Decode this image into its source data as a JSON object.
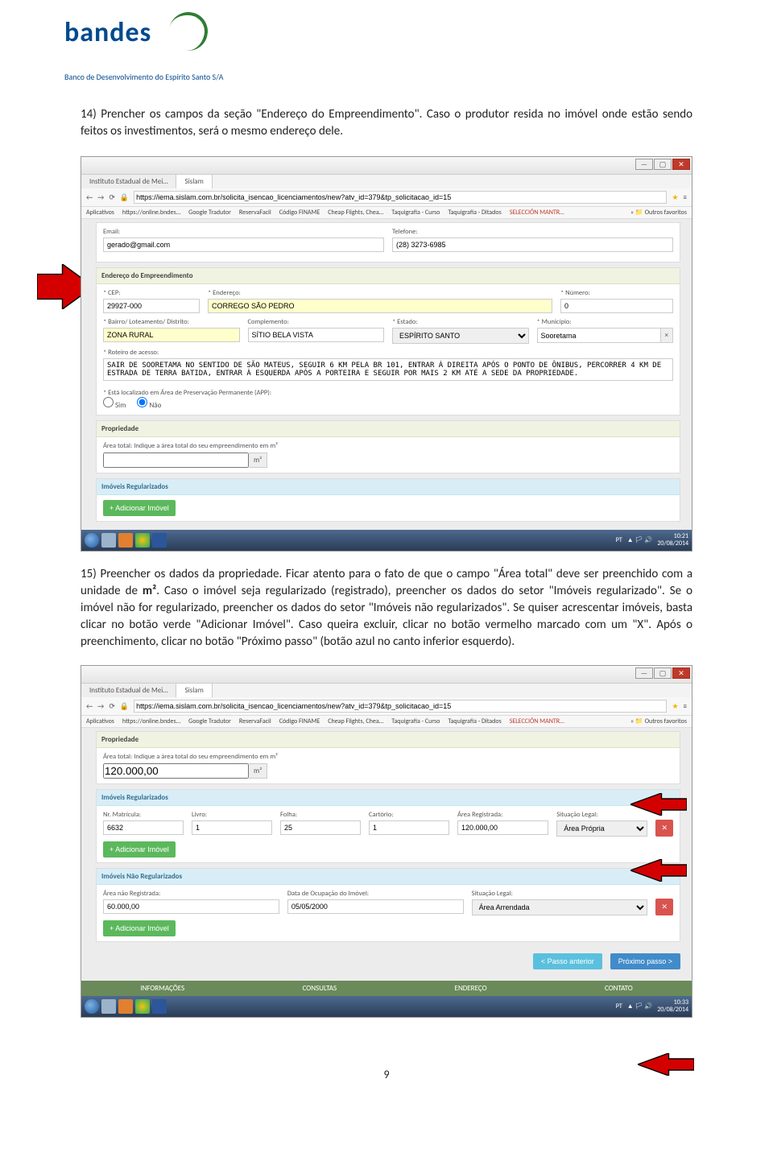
{
  "logo": {
    "brand": "bandes",
    "tagline": "Banco de Desenvolvimento do Espírito Santo S/A"
  },
  "para1": "14) Prencher os campos da seção \"Endereço do Empreendimento\". Caso o produtor resida no imóvel onde estão sendo feitos os investimentos, será o mesmo endereço dele.",
  "para2_a": "15) Preencher os dados da propriedade. Ficar atento para o fato de que o campo \"Área total\" deve ser preenchido com a unidade de ",
  "para2_bold": "m²",
  "para2_b": ". Caso o imóvel seja regularizado (registrado), preencher os dados do setor \"Imóveis regularizado\". Se o imóvel não for regularizado, preencher os dados do setor \"Imóveis não regularizados\". Se quiser acrescentar imóveis, basta clicar no botão verde \"Adicionar Imóvel\". Caso queira excluir, clicar no botão vermelho marcado com um \"X\". Após o preenchimento, clicar no botão \"Próximo passo\" (botão azul no canto inferior esquerdo).",
  "ss1": {
    "tab1": "Instituto Estadual de Mei…",
    "tab2": "Sislam",
    "url": "https://iema.sislam.com.br/solicita_isencao_licenciamentos/new?atv_id=379&tp_solicitacao_id=15",
    "bookmarks": [
      "Aplicativos",
      "https://online.bndes…",
      "Google Tradutor",
      "ReservaFacil",
      "Código FINAME",
      "Cheap Flights, Chea…",
      "Taquigrafia - Curso",
      "Taquigrafia - Ditados",
      "SELECCIÓN MANTR…"
    ],
    "other_fav": "Outros favoritos",
    "email_lbl": "Email:",
    "email_val": "gerado@gmail.com",
    "tel_lbl": "Telefone:",
    "tel_val": "(28) 3273-6985",
    "panel_endereco": "Endereço do Empreendimento",
    "cep_lbl": "* CEP:",
    "cep_val": "29927-000",
    "end_lbl": "* Endereço:",
    "end_val": "CORREGO SÃO PEDRO",
    "num_lbl": "* Número:",
    "num_val": "0",
    "bairro_lbl": "* Bairro/ Loteamento/ Distrito:",
    "bairro_val": "ZONA RURAL",
    "compl_lbl": "Complemento:",
    "compl_val": "SÍTIO BELA VISTA",
    "estado_lbl": "* Estado:",
    "estado_val": "ESPÍRITO SANTO",
    "mun_lbl": "* Município:",
    "mun_val": "Sooretama",
    "rot_lbl": "* Roteiro de acesso:",
    "rot_val": "SAIR DE SOORETAMA NO SENTIDO DE SÃO MATEUS, SEGUIR 6 KM PELA BR 101, ENTRAR À DIREITA APÓS O PONTO DE ÔNIBUS, PERCORRER 4 KM DE ESTRADA DE TERRA BATIDA, ENTRAR À ESQUERDA APÓS A PORTEIRA E SEGUIR POR MAIS 2 KM ATÉ A SEDE DA PROPRIEDADE.",
    "app_lbl": "* Está localizado em Área de Preservação Permanente (APP):",
    "sim": "Sim",
    "nao": "Não",
    "panel_prop": "Propriedade",
    "area_lbl": "Área total: Indique a área total do seu empreendimento em m²",
    "unit": "m²",
    "panel_imoveis": "Imóveis Regularizados",
    "add_btn": "Adicionar Imóvel",
    "clock": "10:21",
    "date": "20/08/2014",
    "lang": "PT"
  },
  "ss2": {
    "tab1": "Instituto Estadual de Mei…",
    "tab2": "Sislam",
    "url": "https://iema.sislam.com.br/solicita_isencao_licenciamentos/new?atv_id=379&tp_solicitacao_id=15",
    "bookmarks": [
      "Aplicativos",
      "https://online.bndes…",
      "Google Tradutor",
      "ReservaFacil",
      "Código FINAME",
      "Cheap Flights, Chea…",
      "Taquigrafia - Curso",
      "Taquigrafia - Ditados",
      "SELECCIÓN MANTR…"
    ],
    "other_fav": "Outros favoritos",
    "panel_prop": "Propriedade",
    "area_lbl": "Área total: Indique a área total do seu empreendimento em m²",
    "area_val": "120.000,00",
    "unit": "m²",
    "panel_reg": "Imóveis Regularizados",
    "nr_mat_lbl": "Nr. Matrícula:",
    "nr_mat_val": "6632",
    "livro_lbl": "Livro:",
    "livro_val": "1",
    "folha_lbl": "Folha:",
    "folha_val": "25",
    "cart_lbl": "Cartório:",
    "cart_val": "1",
    "areareg_lbl": "Área Registrada:",
    "areareg_val": "120.000,00",
    "sit_lbl": "Situação Legal:",
    "sit_val": "Área Própria",
    "add_btn": "Adicionar Imóvel",
    "panel_nreg": "Imóveis Não Regularizados",
    "areanr_lbl": "Área não Registrada:",
    "areanr_val": "60.000,00",
    "dataocp_lbl": "Data de Ocupação do Imóvel:",
    "dataocp_val": "05/05/2000",
    "sit2_lbl": "Situação Legal:",
    "sit2_val": "Área Arrendada",
    "prev": "Passo anterior",
    "next": "Próximo passo",
    "footer": {
      "info": "INFORMAÇÕES",
      "cons": "CONSULTAS",
      "end": "ENDEREÇO",
      "cont": "CONTATO"
    },
    "clock": "10:33",
    "date": "20/08/2014",
    "lang": "PT"
  },
  "page_num": "9"
}
